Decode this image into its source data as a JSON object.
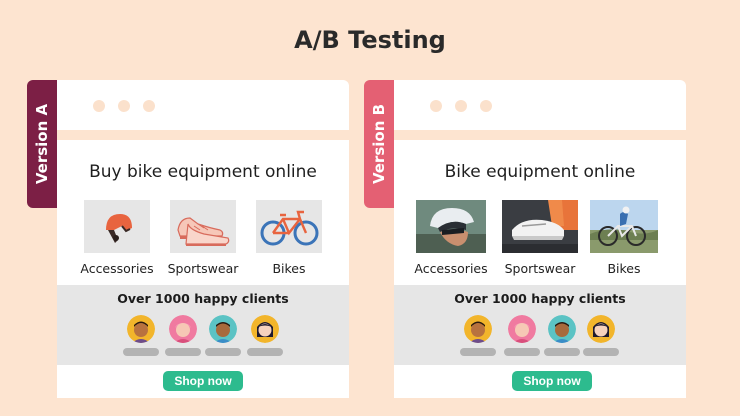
{
  "title": "A/B Testing",
  "colors": {
    "background": "#fde4d0",
    "version_a_tab": "#7c1f45",
    "version_b_tab": "#e46073",
    "cta": "#2dbb8e",
    "clients_band": "#e6e6e6"
  },
  "versions": [
    {
      "label": "Version A",
      "heading": "Buy bike equipment online",
      "products": [
        {
          "label": "Accessories",
          "icon": "helmet-icon"
        },
        {
          "label": "Sportswear",
          "icon": "sneaker-icon"
        },
        {
          "label": "Bikes",
          "icon": "bicycle-icon"
        }
      ],
      "clients_title": "Over 1000 happy clients",
      "avatars": [
        "user-avatar-1",
        "user-avatar-2",
        "user-avatar-3",
        "user-avatar-4"
      ],
      "cta_label": "Shop now"
    },
    {
      "label": "Version B",
      "heading": "Bike equipment online",
      "products": [
        {
          "label": "Accessories",
          "icon": "helmet-photo"
        },
        {
          "label": "Sportswear",
          "icon": "shoe-photo"
        },
        {
          "label": "Bikes",
          "icon": "cyclist-photo"
        }
      ],
      "clients_title": "Over 1000 happy clients",
      "avatars": [
        "user-avatar-1",
        "user-avatar-2",
        "user-avatar-3",
        "user-avatar-4"
      ],
      "cta_label": "Shop now"
    }
  ]
}
